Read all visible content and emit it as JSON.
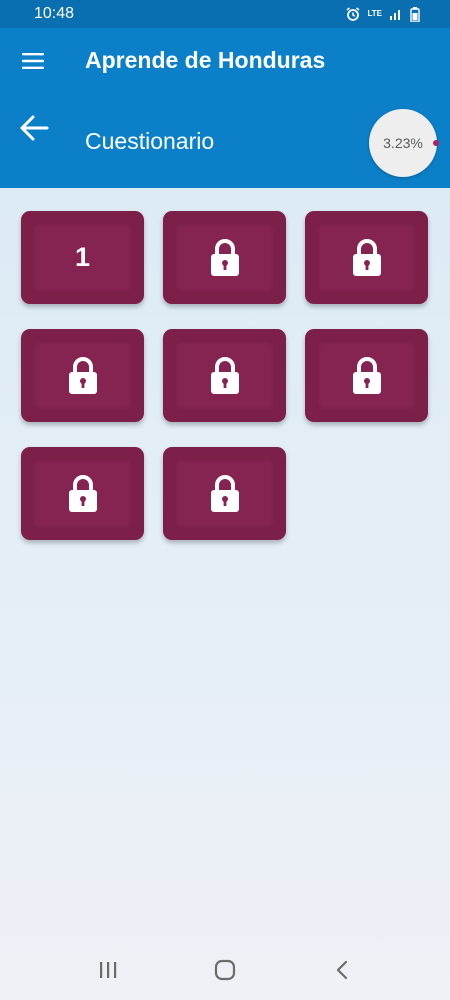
{
  "status_bar": {
    "time": "10:48",
    "network_label": "LTE"
  },
  "app_bar": {
    "title": "Aprende de Honduras",
    "subtitle": "Cuestionario",
    "progress_text": "3.23%",
    "menu_icon": "hamburger-menu-icon",
    "back_icon": "arrow-left-icon"
  },
  "levels": [
    {
      "label": "1",
      "locked": false
    },
    {
      "label": "",
      "locked": true
    },
    {
      "label": "",
      "locked": true
    },
    {
      "label": "",
      "locked": true
    },
    {
      "label": "",
      "locked": true
    },
    {
      "label": "",
      "locked": true
    },
    {
      "label": "",
      "locked": true
    },
    {
      "label": "",
      "locked": true
    }
  ],
  "colors": {
    "primary": "#0b80c9",
    "status_bar": "#0a6fb1",
    "tile": "#7d2049",
    "tile_inner": "#862451",
    "progress_accent": "#b0205a"
  },
  "nav_bar": {
    "icons": [
      "recent-apps-icon",
      "home-icon",
      "back-icon"
    ]
  }
}
